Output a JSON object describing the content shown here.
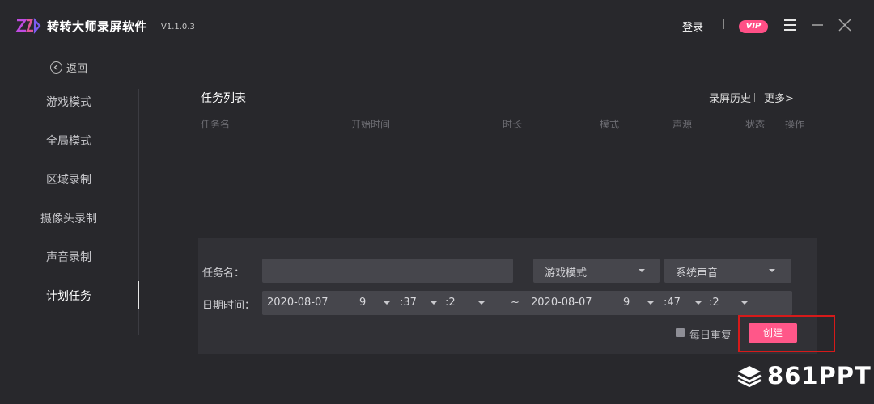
{
  "app": {
    "name": "转转大师录屏软件",
    "version": "V1.1.0.3",
    "login_label": "登录",
    "vip_label": "VIP"
  },
  "nav": {
    "back_label": "返回",
    "items": [
      {
        "label": "游戏模式",
        "active": false
      },
      {
        "label": "全局模式",
        "active": false
      },
      {
        "label": "区域录制",
        "active": false
      },
      {
        "label": "摄像头录制",
        "active": false
      },
      {
        "label": "声音录制",
        "active": false
      },
      {
        "label": "计划任务",
        "active": true
      }
    ]
  },
  "task_list": {
    "title": "任务列表",
    "history_label": "录屏历史",
    "more_label": "更多>",
    "columns": [
      "任务名",
      "开始时间",
      "时长",
      "模式",
      "声源",
      "状态",
      "操作"
    ]
  },
  "form": {
    "name_label": "任务名：",
    "name_value": "",
    "mode_value": "游戏模式",
    "audio_value": "系统声音",
    "datetime_label": "日期时间：",
    "start": {
      "date": "2020-08-07",
      "hour": "9",
      "minute": ":37",
      "second": ":2"
    },
    "range_sep": "~",
    "end": {
      "date": "2020-08-07",
      "hour": "9",
      "minute": ":47",
      "second": ":2"
    },
    "repeat_label": "每日重复",
    "repeat_checked": false,
    "create_label": "创建"
  },
  "watermark": {
    "text": "861PPT"
  },
  "colors": {
    "background": "#28282c",
    "panel": "#313136",
    "input": "#46464c",
    "accent": "#ff5789",
    "highlight": "#d61a1a"
  }
}
